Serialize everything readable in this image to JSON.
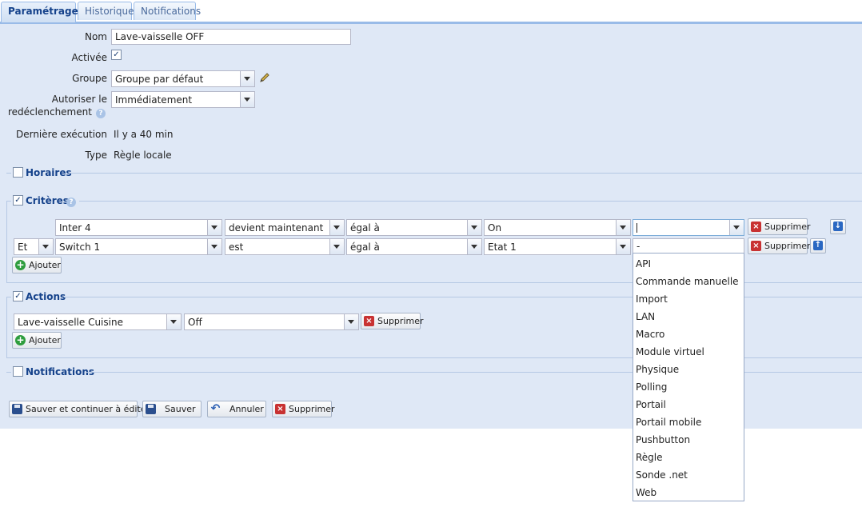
{
  "tabs": [
    {
      "label": "Paramétrage"
    },
    {
      "label": "Historique"
    },
    {
      "label": "Notifications"
    }
  ],
  "form": {
    "nom_label": "Nom",
    "nom_value": "Lave-vaisselle OFF",
    "activee_label": "Activée",
    "groupe_label": "Groupe",
    "groupe_value": "Groupe par défaut",
    "autoriser_label_1": "Autoriser le",
    "autoriser_label_2": "redéclenchement",
    "autoriser_value": "Immédiatement",
    "derniere_label": "Dernière exécution",
    "derniere_value": "Il y a 40 min",
    "type_label": "Type",
    "type_value": "Règle locale"
  },
  "sections": {
    "horaires": "Horaires",
    "criteres": "Critères",
    "actions": "Actions",
    "notifications": "Notifications"
  },
  "criteria": [
    {
      "conj": "",
      "device": "Inter 4",
      "op": "devient maintenant",
      "cmp": "égal à",
      "value": "On",
      "source": "",
      "delete": "Supprimer"
    },
    {
      "conj": "Et",
      "device": "Switch 1",
      "op": "est",
      "cmp": "égal à",
      "value": "Etat 1",
      "source": "-",
      "delete": "Supprimer"
    }
  ],
  "criteria_add": "Ajouter",
  "actions": [
    {
      "device": "Lave-vaisselle Cuisine",
      "value": "Off",
      "delete": "Supprimer"
    }
  ],
  "actions_add": "Ajouter",
  "buttons": {
    "save_continue": "Sauver et continuer à éditer",
    "save": "Sauver",
    "cancel": "Annuler",
    "delete": "Supprimer"
  },
  "source_options": [
    "API",
    "Commande manuelle",
    "Import",
    "LAN",
    "Macro",
    "Module virtuel",
    "Physique",
    "Polling",
    "Portail",
    "Portail mobile",
    "Pushbutton",
    "Règle",
    "Sonde .net",
    "Web"
  ],
  "colors": {
    "accent": "#15428b",
    "panel": "#dfe8f6",
    "border": "#99bbe8"
  }
}
